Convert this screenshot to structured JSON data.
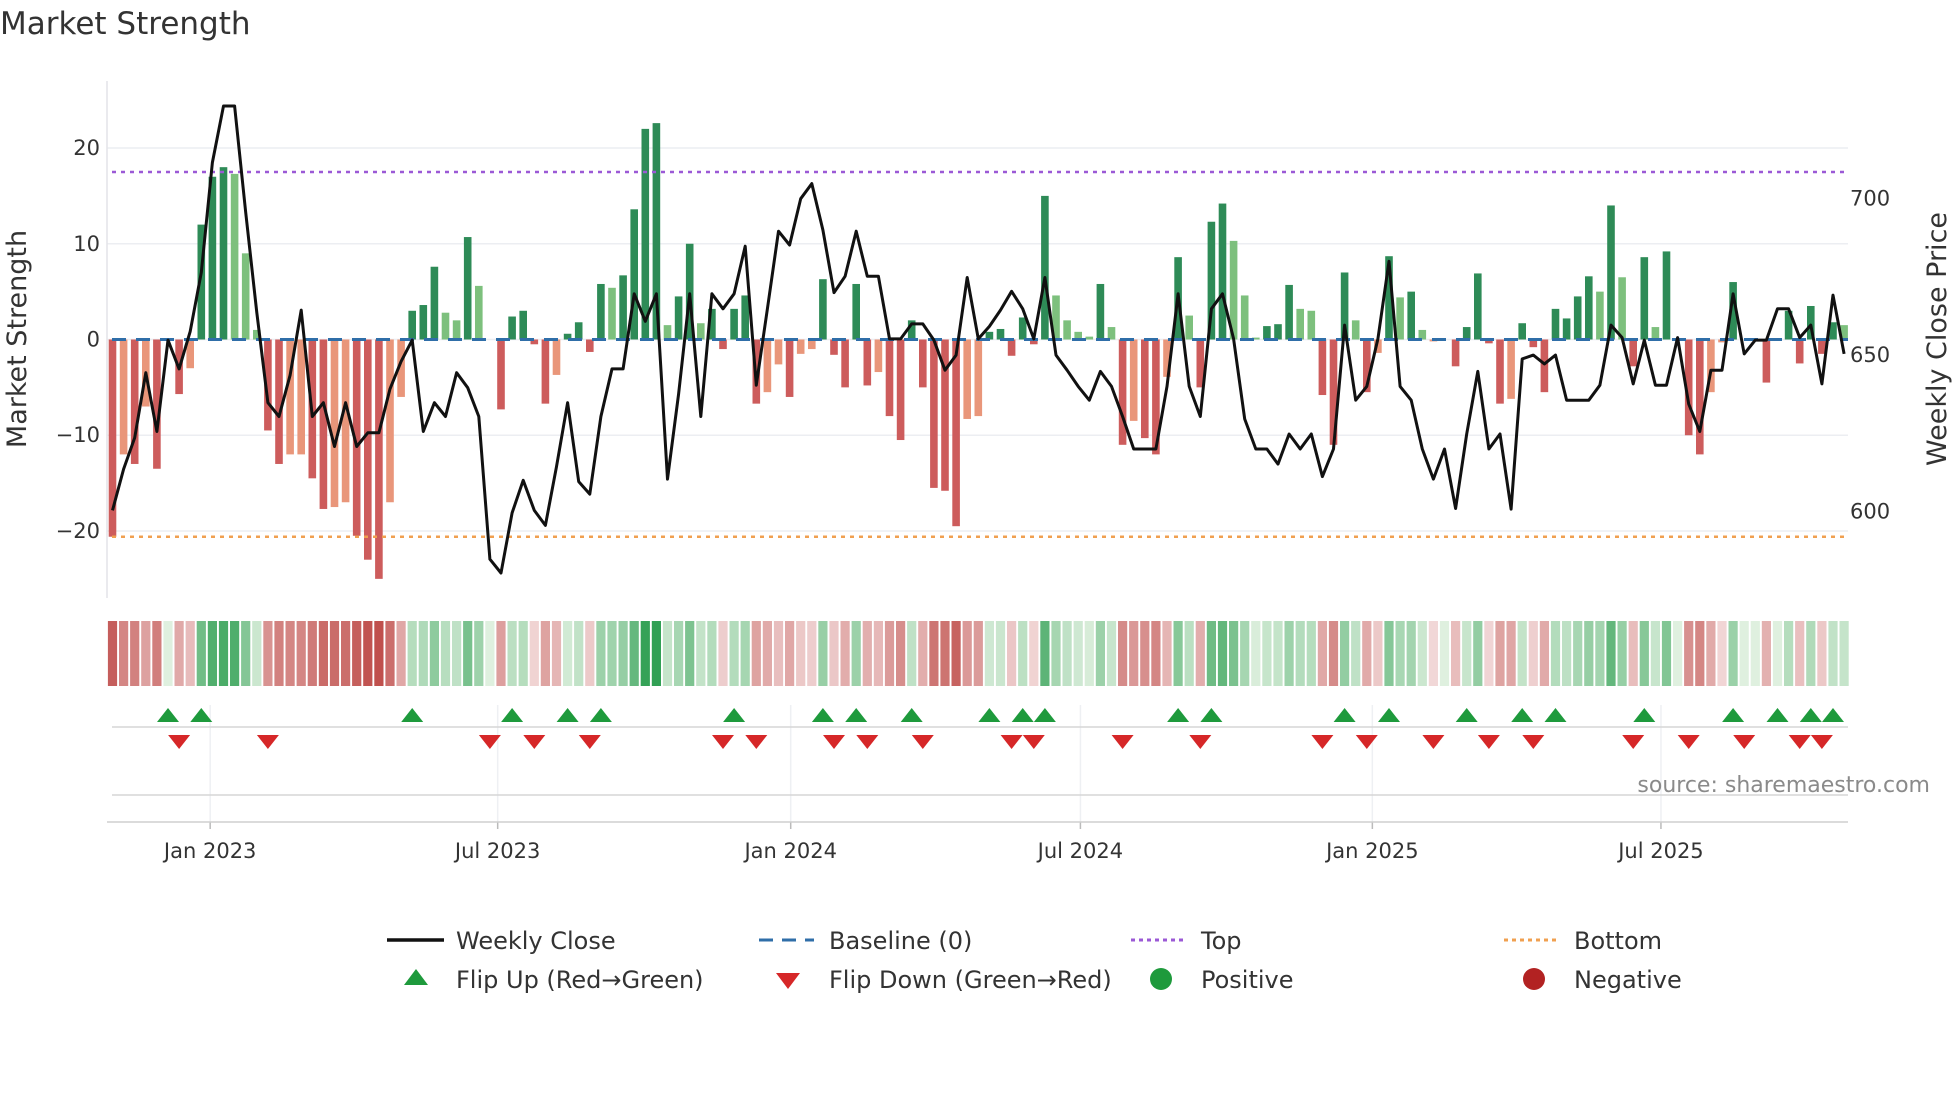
{
  "title": "Market Strength",
  "source": "source: sharemaestro.com",
  "colors": {
    "strong_green": "#2e8b57",
    "light_green": "#7dc07d",
    "strong_red": "#cd5c5c",
    "light_red": "#e9967a",
    "top": "#9b59d6",
    "bottom": "#f0a050",
    "baseline": "#2f6ea8",
    "flip_up": "#1e9a3c",
    "flip_down": "#d62728",
    "line": "#111111"
  },
  "legend": {
    "weekly_close": "Weekly Close",
    "baseline": "Baseline (0)",
    "top": "Top",
    "bottom": "Bottom",
    "flip_up": "Flip Up (Red→Green)",
    "flip_down": "Flip Down (Green→Red)",
    "positive": "Positive",
    "negative": "Negative"
  },
  "chart_data": {
    "type": "bar",
    "title": "Market Strength",
    "ylabel": "Market Strength",
    "y2label": "Weekly Close Price",
    "ylim": [
      -27,
      27
    ],
    "y2lim": [
      572.4,
      737.6
    ],
    "yticks": [
      {
        "v": 20,
        "label": "20"
      },
      {
        "v": 10,
        "label": "10"
      },
      {
        "v": 0,
        "label": "0"
      },
      {
        "v": -10,
        "label": "−10"
      },
      {
        "v": -20,
        "label": "−20"
      }
    ],
    "y2ticks": [
      {
        "v": 700,
        "label": "700"
      },
      {
        "v": 650,
        "label": "650"
      },
      {
        "v": 600,
        "label": "600"
      }
    ],
    "xticks": [
      {
        "week": 8.8,
        "label": "Jan 2023"
      },
      {
        "week": 34.7,
        "label": "Jul 2023"
      },
      {
        "week": 61.1,
        "label": "Jan 2024"
      },
      {
        "week": 87.2,
        "label": "Jul 2024"
      },
      {
        "week": 113.5,
        "label": "Jan 2025"
      },
      {
        "week": 139.5,
        "label": "Jul 2025"
      }
    ],
    "top_level": 17.5,
    "bottom_level": -20.6,
    "strength": [
      -20.6,
      -12,
      -13,
      -7,
      -13.5,
      0,
      -5.7,
      -3,
      12,
      17,
      18,
      17.3,
      9,
      1,
      -9.5,
      -13,
      -12,
      -12,
      -14.5,
      -17.7,
      -17.5,
      -17,
      -20.5,
      -23,
      -25,
      -17,
      -6,
      3,
      3.6,
      7.6,
      2.8,
      2,
      10.7,
      5.6,
      0,
      -7.3,
      2.4,
      3,
      -0.5,
      -6.7,
      -3.7,
      0.6,
      1.8,
      -1.3,
      5.8,
      5.4,
      6.7,
      13.6,
      22,
      22.6,
      1.5,
      4.5,
      10,
      1.7,
      3.2,
      -1,
      3.2,
      4.6,
      -6.7,
      -5.5,
      -2.6,
      -6,
      -1.5,
      -1,
      6.3,
      -1.6,
      -5,
      5.8,
      -4.8,
      -3.4,
      -8,
      -10.5,
      2,
      -5,
      -15.5,
      -15.8,
      -19.5,
      -8.3,
      -8,
      0.8,
      1.1,
      -1.7,
      2.3,
      -0.5,
      15,
      4.6,
      2,
      0.8,
      0.3,
      5.8,
      1.3,
      -11,
      -8.5,
      -10.3,
      -12,
      -3.9,
      8.6,
      2.5,
      -5,
      12.3,
      14.2,
      10.3,
      4.6,
      0.2,
      1.4,
      1.6,
      5.7,
      3.2,
      3,
      -5.8,
      -11,
      7,
      2,
      -5.5,
      -1.4,
      8.7,
      4.4,
      5,
      1,
      -0.2,
      0,
      -2.8,
      1.3,
      6.9,
      -0.4,
      -6.7,
      -6.2,
      1.7,
      -0.8,
      -5.5,
      3.2,
      2.2,
      4.5,
      6.6,
      5,
      14,
      6.5,
      -2.8,
      8.6,
      1.3,
      9.2,
      0,
      -10,
      -12,
      -5.5,
      -0.3,
      6,
      0,
      0,
      -4.5,
      0,
      3,
      -2.5,
      3.5,
      -1.5,
      1.8,
      1.5
    ],
    "bar_shade": "RrRrRNRrGGGgggRRrrRRrrRRRrrGGGggGgNRGGRRrGGRGgGGGGgGGgGRGGRrrRrrGRRGRrRRGRRRRrrGGRGRGggggGgRrRRrGgRGGgggGGGggRRGgRrGgGgrNRGGRRrGRRGGGGgGgRGgGNRRrrGNNRNGRGRGg",
    "weekly_close": [
      600.4,
      613.6,
      623.6,
      644.4,
      625.6,
      654.8,
      645.6,
      657.6,
      676.4,
      711.6,
      729.6,
      729.6,
      695.6,
      663.6,
      634.8,
      630.4,
      643.6,
      664.4,
      630.4,
      634.8,
      620.8,
      634.8,
      620.8,
      625.2,
      625.2,
      639.2,
      648,
      654.8,
      625.6,
      634.8,
      630.4,
      644.4,
      639.6,
      630.4,
      584.8,
      580.4,
      599.6,
      610,
      600.4,
      595.6,
      614.4,
      634.8,
      609.6,
      605.6,
      630.4,
      645.6,
      645.6,
      669.6,
      660.8,
      669.6,
      610.4,
      637.6,
      669.6,
      630.4,
      669.6,
      664.8,
      669.6,
      684.8,
      640.4,
      664.8,
      689.6,
      685.2,
      700,
      704.8,
      690,
      670,
      675.2,
      689.6,
      675.2,
      675.2,
      655.2,
      655.2,
      660,
      660,
      654.8,
      645.2,
      650,
      674.8,
      655.2,
      659.2,
      664.4,
      670.4,
      664.8,
      655.2,
      674.8,
      650,
      645.2,
      640,
      635.6,
      644.8,
      640,
      630.4,
      620,
      620,
      620,
      640,
      669.6,
      640,
      630.4,
      664.8,
      669.6,
      655.2,
      629.6,
      620,
      620,
      615.2,
      624.8,
      620,
      624.8,
      611.2,
      620,
      659.6,
      635.6,
      640,
      655.2,
      680,
      640,
      635.6,
      620,
      610.4,
      620,
      601,
      624.8,
      644.8,
      620,
      624.8,
      600.8,
      648.8,
      650,
      647.2,
      650,
      635.6,
      635.6,
      635.6,
      640.4,
      659.6,
      655.6,
      640.8,
      654.8,
      640.4,
      640.4,
      655.6,
      634.4,
      625.6,
      645.2,
      645.2,
      669.6,
      650.4,
      654.8,
      654.8,
      664.8,
      664.8,
      655.6,
      659.6,
      640.8,
      669.2,
      650.4
    ],
    "flip_up_weeks": [
      5,
      8,
      27,
      36,
      41,
      44,
      56,
      64,
      67,
      72,
      79,
      82,
      84,
      96,
      99,
      111,
      115,
      122,
      127,
      130,
      138,
      146,
      150,
      153,
      155
    ],
    "flip_down_weeks": [
      6,
      14,
      34,
      38,
      43,
      55,
      58,
      65,
      68,
      73,
      81,
      83,
      91,
      98,
      109,
      113,
      119,
      124,
      128,
      137,
      142,
      147,
      152,
      154
    ]
  }
}
